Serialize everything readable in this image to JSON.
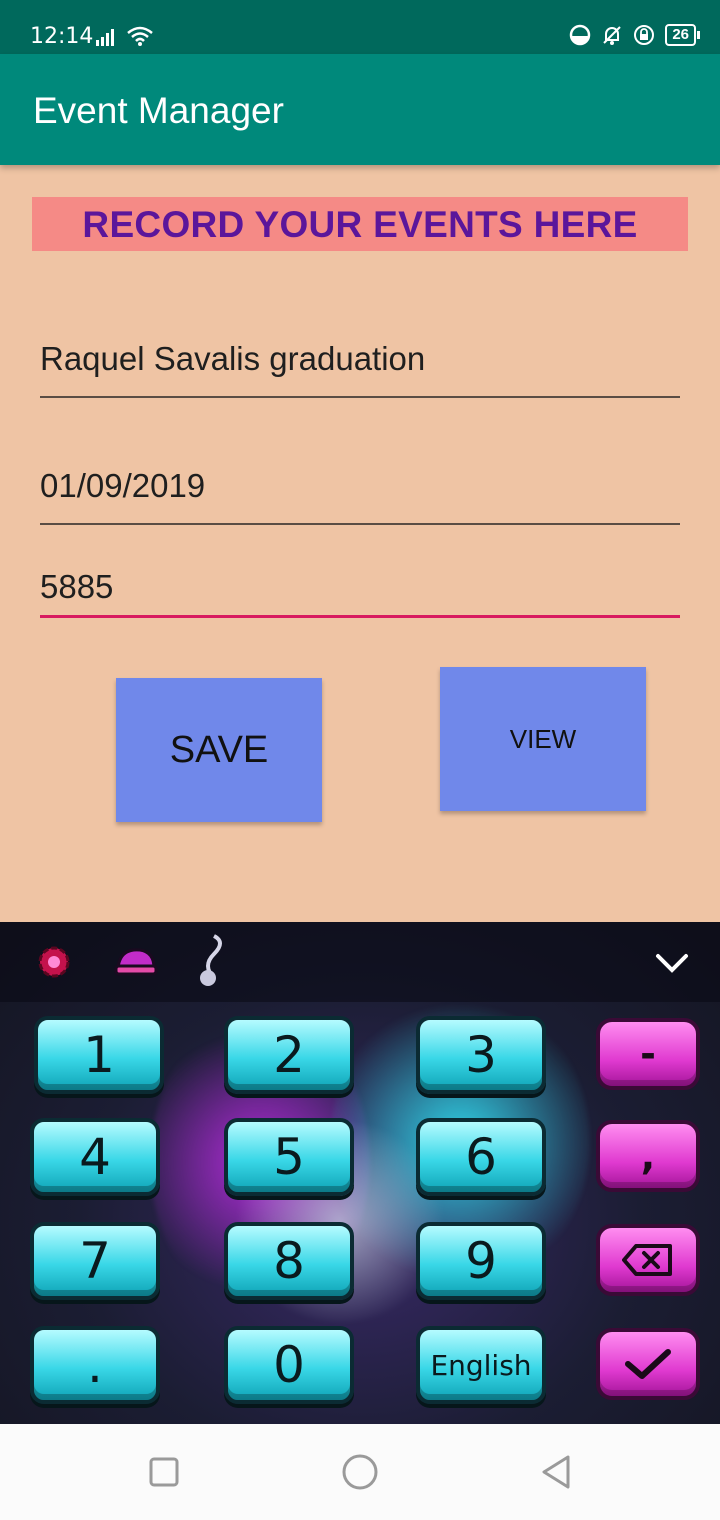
{
  "status_bar": {
    "time": "12:14",
    "battery": "26",
    "icons": [
      "signal-icon",
      "wifi-icon",
      "data-saver-icon",
      "bell-off-icon",
      "vpn-lock-icon",
      "battery-icon"
    ]
  },
  "app_bar": {
    "title": "Event Manager"
  },
  "banner": {
    "text": "RECORD YOUR EVENTS HERE"
  },
  "form": {
    "event_name": "Raquel Savalis graduation",
    "event_date": "01/09/2019",
    "event_code": "5885"
  },
  "buttons": {
    "save": "SAVE",
    "view": "VIEW"
  },
  "keyboard": {
    "keys": [
      {
        "label": "1"
      },
      {
        "label": "2"
      },
      {
        "label": "3"
      },
      {
        "label": "4"
      },
      {
        "label": "5"
      },
      {
        "label": "6"
      },
      {
        "label": "7"
      },
      {
        "label": "8"
      },
      {
        "label": "9"
      },
      {
        "label": "."
      },
      {
        "label": "0"
      },
      {
        "label": "English"
      }
    ],
    "side_keys": [
      {
        "label": "-"
      },
      {
        "label": ","
      },
      {
        "label": "backspace"
      },
      {
        "label": "enter"
      }
    ],
    "colors": {
      "key": "#39d7e7",
      "side_key": "#e03ad0"
    }
  },
  "colors": {
    "app_bar": "#00897b",
    "status_bar": "#00695c",
    "background": "#efc4a4",
    "banner": "#f58a86",
    "banner_text": "#5b169b",
    "button": "#7088ea",
    "focus_line": "#d81b60"
  }
}
